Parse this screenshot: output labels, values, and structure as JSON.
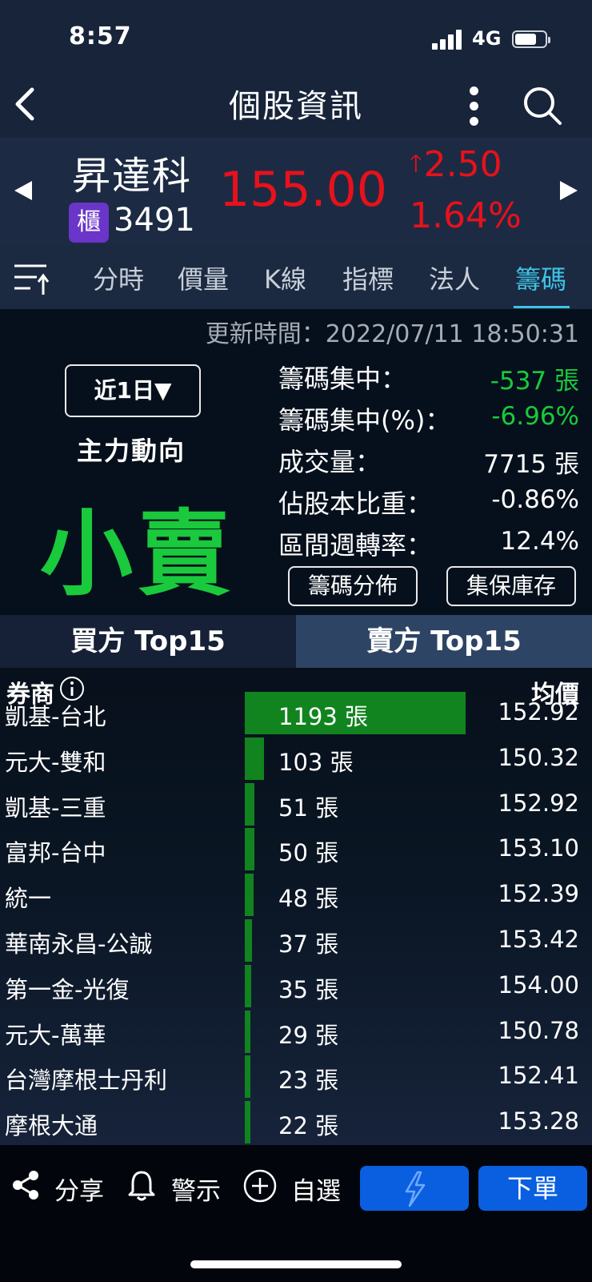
{
  "status_bar": {
    "time": "8:57",
    "network": "4G"
  },
  "header": {
    "title": "個股資訊"
  },
  "stock": {
    "name": "昇達科",
    "market_badge": "櫃",
    "code": "3491",
    "price": "155.00",
    "change": "2.50",
    "change_pct": "1.64%",
    "up_color": "#e8111b"
  },
  "tabs": [
    {
      "label": "分時"
    },
    {
      "label": "價量"
    },
    {
      "label": "K線"
    },
    {
      "label": "指標"
    },
    {
      "label": "法人"
    },
    {
      "label": "籌碼",
      "active": true
    }
  ],
  "update_time": "更新時間：2022/07/11 18:50:31",
  "summary": {
    "period": "近1日▼",
    "main_flow_label": "主力動向",
    "main_flow_value": "小賣",
    "stats": [
      {
        "label": "籌碼集中：",
        "value": "-537 張",
        "color": "green"
      },
      {
        "label": "籌碼集中(%)：",
        "value": "-6.96%",
        "color": "green"
      },
      {
        "label": "成交量：",
        "value": "7715 張"
      },
      {
        "label": "佔股本比重：",
        "value": "-0.86%"
      },
      {
        "label": "區間週轉率：",
        "value": "12.4%"
      }
    ],
    "buttons": {
      "distribution": "籌碼分佈",
      "depository": "集保庫存"
    }
  },
  "side_tabs": {
    "buy": "買方 Top15",
    "sell": "賣方 Top15",
    "active": "sell"
  },
  "table": {
    "header_broker": "券商",
    "header_avg": "均價",
    "rows": [
      {
        "broker": "凱基-台北",
        "qty": "1193 張",
        "qty_num": 1193,
        "avg": "152.92"
      },
      {
        "broker": "元大-雙和",
        "qty": "103 張",
        "qty_num": 103,
        "avg": "150.32"
      },
      {
        "broker": "凱基-三重",
        "qty": "51 張",
        "qty_num": 51,
        "avg": "152.92"
      },
      {
        "broker": "富邦-台中",
        "qty": "50 張",
        "qty_num": 50,
        "avg": "153.10"
      },
      {
        "broker": "統一",
        "qty": "48 張",
        "qty_num": 48,
        "avg": "152.39"
      },
      {
        "broker": "華南永昌-公誠",
        "qty": "37 張",
        "qty_num": 37,
        "avg": "153.42"
      },
      {
        "broker": "第一金-光復",
        "qty": "35 張",
        "qty_num": 35,
        "avg": "154.00"
      },
      {
        "broker": "元大-萬華",
        "qty": "29 張",
        "qty_num": 29,
        "avg": "150.78"
      },
      {
        "broker": "台灣摩根士丹利",
        "qty": "23 張",
        "qty_num": 23,
        "avg": "152.41"
      },
      {
        "broker": "摩根大通",
        "qty": "22 張",
        "qty_num": 22,
        "avg": "153.28"
      }
    ]
  },
  "bottom_bar": {
    "share": "分享",
    "alert": "警示",
    "watchlist": "自選",
    "order": "下單"
  }
}
